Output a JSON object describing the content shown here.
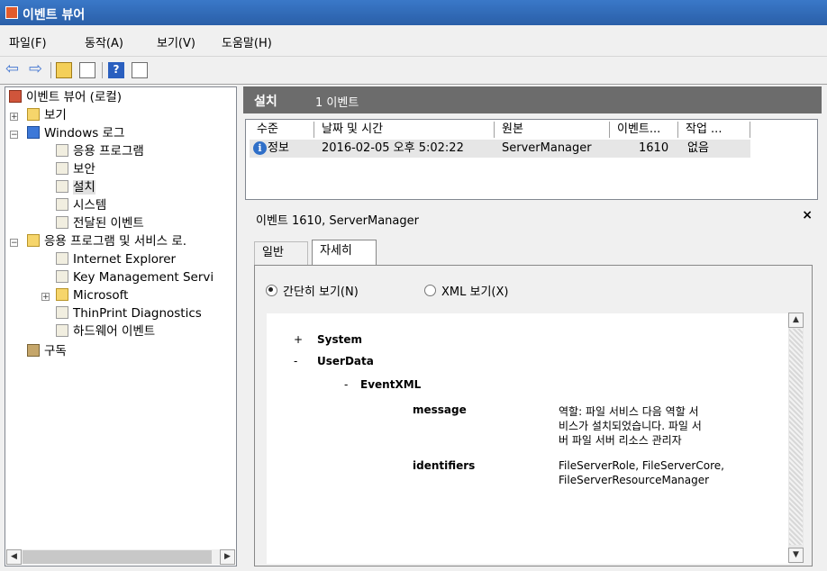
{
  "window": {
    "title": "이벤트 뷰어"
  },
  "menu": [
    "파일(F)",
    "동작(A)",
    "보기(V)",
    "도움말(H)"
  ],
  "tree": {
    "root": "이벤트 뷰어 (로컬)",
    "views": "보기",
    "windows_logs": "Windows 로그",
    "logs": [
      "응용 프로그램",
      "보안",
      "설치",
      "시스템",
      "전달된 이벤트"
    ],
    "apps_services": "응용 프로그램 및 서비스 로.",
    "app_items": [
      "Internet Explorer",
      "Key Management Servi",
      "Microsoft",
      "ThinPrint Diagnostics",
      "하드웨어 이벤트"
    ],
    "subscriptions": "구독"
  },
  "events": {
    "title": "설치",
    "count": "1 이벤트",
    "columns": [
      "수준",
      "날짜 및 시간",
      "원본",
      "이벤트...",
      "작업 ..."
    ],
    "rows": [
      {
        "level": "정보",
        "datetime": "2016-02-05 오후 5:02:22",
        "source": "ServerManager",
        "event_id": "1610",
        "task": "없음"
      }
    ]
  },
  "detail": {
    "title": "이벤트 1610, ServerManager",
    "close": "×",
    "tabs": [
      "일반",
      "자세히"
    ],
    "view_options": [
      "간단히 보기(N)",
      "XML 보기(X)"
    ],
    "xml": {
      "system": "System",
      "userdata": "UserData",
      "eventxml": "EventXML",
      "message_key": "message",
      "message_lines": [
        "역할: 파일 서비스 다음 역할 서",
        "비스가 설치되었습니다. 파일 서",
        "버 파일 서버 리소스 관리자"
      ],
      "identifiers_key": "identifiers",
      "identifiers_lines": [
        "FileServerRole, FileServerCore,",
        "FileServerResourceManager"
      ],
      "plus": "+",
      "minus": "-"
    }
  },
  "icons": [
    "app-icon",
    "back-arrow-icon",
    "forward-arrow-icon",
    "up-folder-icon",
    "show-hide-tree-icon",
    "help-icon",
    "action-pane-icon",
    "info-icon"
  ]
}
